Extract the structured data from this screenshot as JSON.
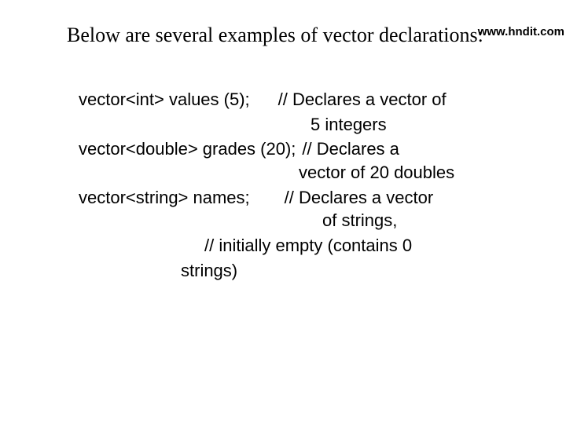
{
  "watermark": "www.hndit.com",
  "intro": "Below are several examples of vector declarations:",
  "code": {
    "decl1": "vector<int> values (5);",
    "comment1a": "// Declares a vector of",
    "comment1b": "5 integers",
    "decl2": "vector<double> grades (20);",
    "comment2a": "// Declares a",
    "comment2b": "vector of 20 doubles",
    "decl3": "vector<string> names;",
    "comment3a": "// Declares a vector",
    "comment3b": "of strings,",
    "comment3c": "// initially empty (contains 0",
    "comment3d": "strings)"
  }
}
